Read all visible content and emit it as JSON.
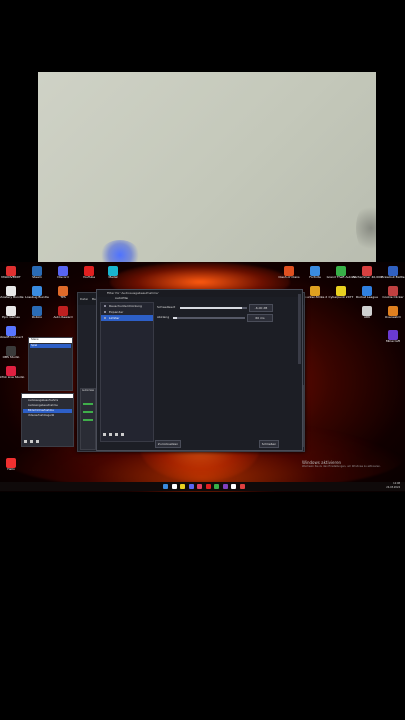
{
  "webcam": {},
  "desktop_icons": {
    "left": [
      {
        "label": "MILKOVERDT",
        "color": "#e03030"
      },
      {
        "label": "Steam",
        "color": "#2a6bb5"
      },
      {
        "label": "Discord",
        "color": "#5865f2"
      },
      {
        "label": "YouTube",
        "color": "#e02020"
      },
      {
        "label": "Medal",
        "color": "#19b5d0"
      },
      {
        "label": "Ghostery Bundle",
        "color": "#e8e8e8"
      },
      {
        "label": "Lossbug Bundle",
        "color": "#3a8be0"
      },
      {
        "label": "TPS",
        "color": "#e06a2a"
      },
      {
        "label": "Epic Games",
        "color": "#e8e8e8"
      },
      {
        "label": "Roblox",
        "color": "#2a6bb5"
      },
      {
        "label": "Auto Reward",
        "color": "#c02020"
      },
      {
        "label": "Ubisoft Connect",
        "color": "#5875ff"
      },
      {
        "label": "OBS Studio",
        "color": "#3a3a3a"
      },
      {
        "label": "TikTok Live Studio",
        "color": "#e02040"
      },
      {
        "label": "Hallo",
        "color": "#f03030"
      }
    ],
    "right": [
      {
        "label": "Clash of Clans",
        "color": "#e05020"
      },
      {
        "label": "Fortnite",
        "color": "#3a8be0"
      },
      {
        "label": "Grand Theft Auto V",
        "color": "#38b048"
      },
      {
        "label": "Warhammer 40,000",
        "color": "#d84040"
      },
      {
        "label": "Brawlout Battle",
        "color": "#3060c0"
      },
      {
        "label": "Counter-Strike 2",
        "color": "#e0a020"
      },
      {
        "label": "Cyberpunk 2077",
        "color": "#e8d020"
      },
      {
        "label": "Rocket League",
        "color": "#3080e0"
      },
      {
        "label": "Cookie Clicker",
        "color": "#c04040"
      },
      {
        "label": "ARK",
        "color": "#d0d0d0"
      },
      {
        "label": "Overwatch",
        "color": "#e08020"
      },
      {
        "label": "Minecraft",
        "color": "#6a3ad0"
      }
    ]
  },
  "obs": {
    "title": "Filter für 'Audioausgabeaufnahme'",
    "menu": [
      "Datei",
      "Bearbeiten"
    ],
    "scenes": [
      "Szene",
      "Spiel"
    ],
    "sources": [
      "Audioausgabeaufnahme",
      "Audioeingabeaufnahme",
      "Bildschirmaufnahme",
      "Videoaufnahmegerät"
    ],
    "mixer_title": "Audiomixer"
  },
  "filter_dialog": {
    "header": "Audiofilter",
    "filters": [
      "Rauschunterdrückung",
      "Expander",
      "Limiter"
    ],
    "selected_index": 2,
    "threshold_label": "Schwellwert",
    "threshold_value": "-6,00 dB",
    "threshold_fraction": 0.92,
    "release_label": "Abklang",
    "release_value": "60 ms",
    "release_fraction": 0.05,
    "defaults_button": "Zurücksetzen",
    "close_button": "Schließen"
  },
  "watermark": {
    "line1": "Windows aktivieren",
    "line2": "Wechseln Sie zu den Einstellungen, um Windows zu aktivieren."
  },
  "taskbar": {
    "time": "12:08",
    "date": "24.03.2024",
    "apps": [
      "#3a8be0",
      "#ffffff",
      "#e8d020",
      "#5865f2",
      "#e04060",
      "#e02020",
      "#38b048",
      "#8040c0",
      "#ffffff",
      "#e04040"
    ]
  }
}
